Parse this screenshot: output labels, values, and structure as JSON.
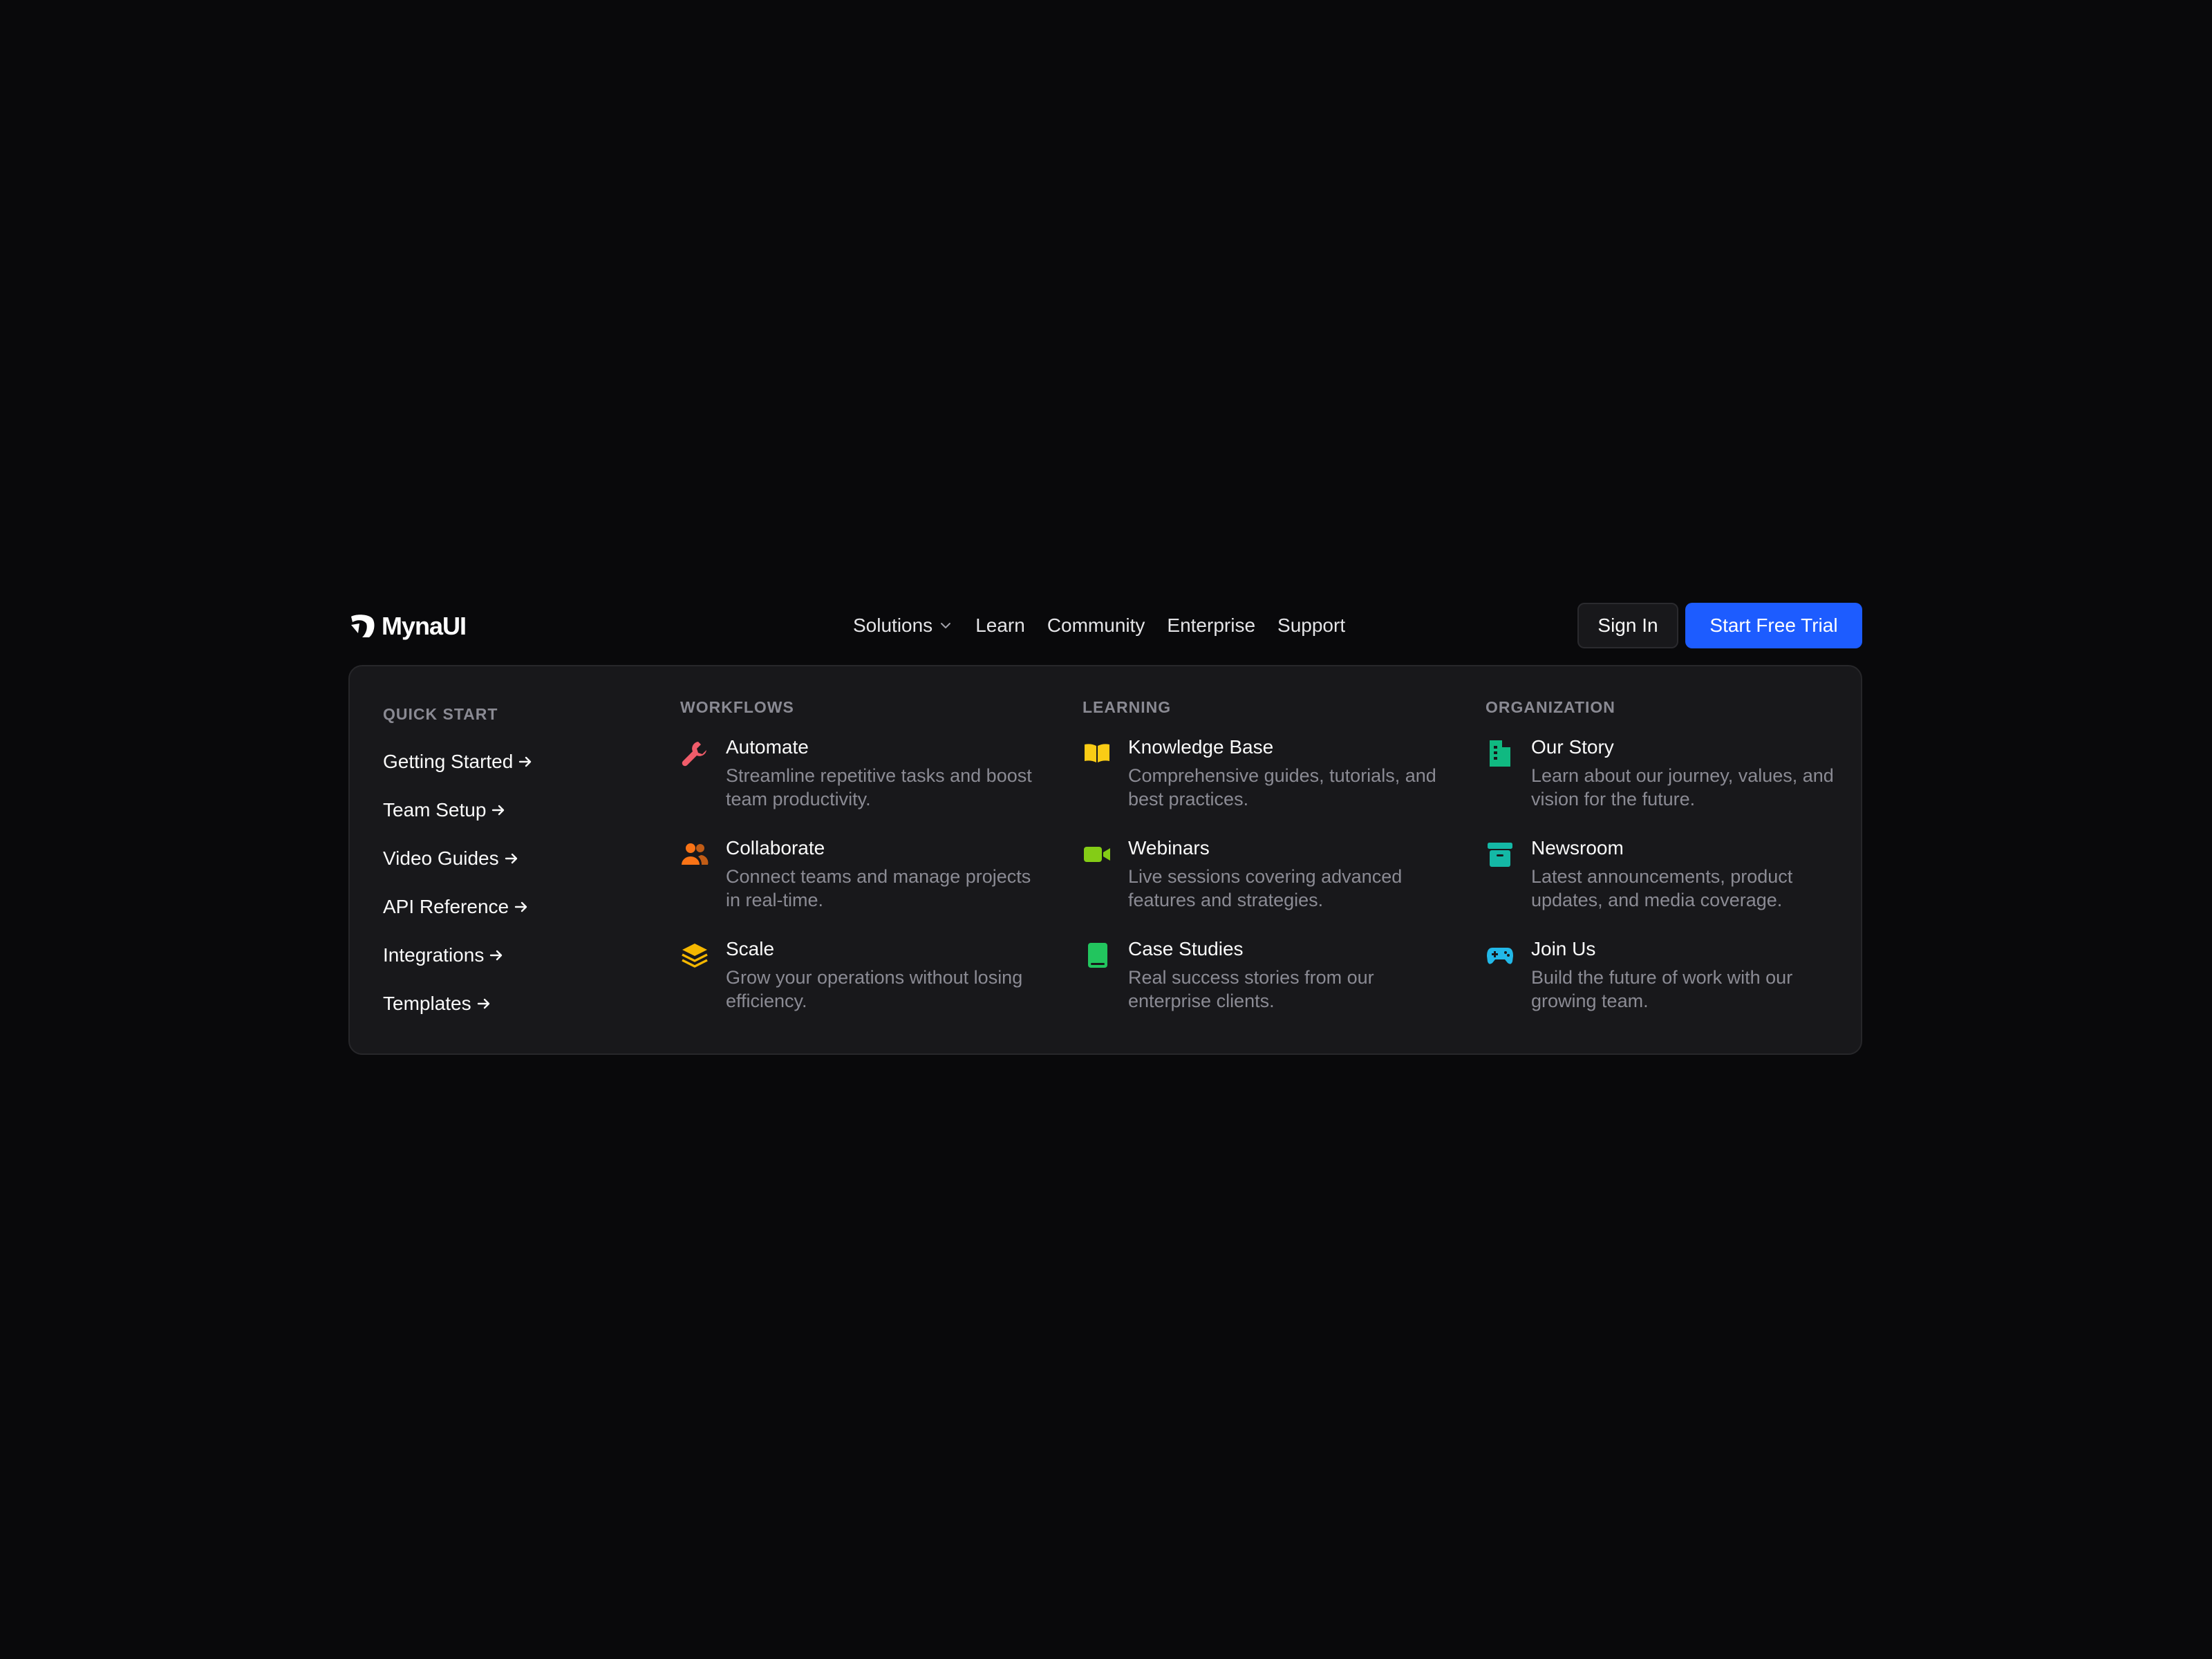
{
  "brand": {
    "name": "MynaUI"
  },
  "nav": {
    "links": [
      "Solutions",
      "Learn",
      "Community",
      "Enterprise",
      "Support"
    ]
  },
  "actions": {
    "sign_in": "Sign In",
    "trial": "Start Free Trial"
  },
  "colors": {
    "background": "#09090b",
    "panel": "#18181b",
    "accent": "#1d5cff"
  },
  "menu": {
    "quick_start": {
      "title": "Quick Start",
      "links": [
        "Getting Started",
        "Team Setup",
        "Video Guides",
        "API Reference",
        "Integrations",
        "Templates"
      ]
    },
    "columns": [
      {
        "title": "Workflows",
        "items": [
          {
            "title": "Automate",
            "desc": "Streamline repetitive tasks and boost team productivity.",
            "icon": "wrench-icon",
            "color": "#f05c6a"
          },
          {
            "title": "Collaborate",
            "desc": "Connect teams and manage projects in real-time.",
            "icon": "users-icon",
            "color": "#f97316"
          },
          {
            "title": "Scale",
            "desc": "Grow your operations without losing efficiency.",
            "icon": "layers-icon",
            "color": "#f5b700"
          }
        ]
      },
      {
        "title": "Learning",
        "items": [
          {
            "title": "Knowledge Base",
            "desc": "Comprehensive guides, tutorials, and best practices.",
            "icon": "book-open-icon",
            "color": "#facc15"
          },
          {
            "title": "Webinars",
            "desc": "Live sessions covering advanced features and strategies.",
            "icon": "video-camera-icon",
            "color": "#84cc16"
          },
          {
            "title": "Case Studies",
            "desc": "Real success stories from our enterprise clients.",
            "icon": "book-icon",
            "color": "#22c55e"
          }
        ]
      },
      {
        "title": "Organization",
        "items": [
          {
            "title": "Our Story",
            "desc": "Learn about our journey, values, and vision for the future.",
            "icon": "building-icon",
            "color": "#10b981"
          },
          {
            "title": "Newsroom",
            "desc": "Latest announcements, product updates, and media coverage.",
            "icon": "archive-icon",
            "color": "#14b8a6"
          },
          {
            "title": "Join Us",
            "desc": "Build the future of work with our growing team.",
            "icon": "gamepad-icon",
            "color": "#22b8e8"
          }
        ]
      }
    ]
  }
}
